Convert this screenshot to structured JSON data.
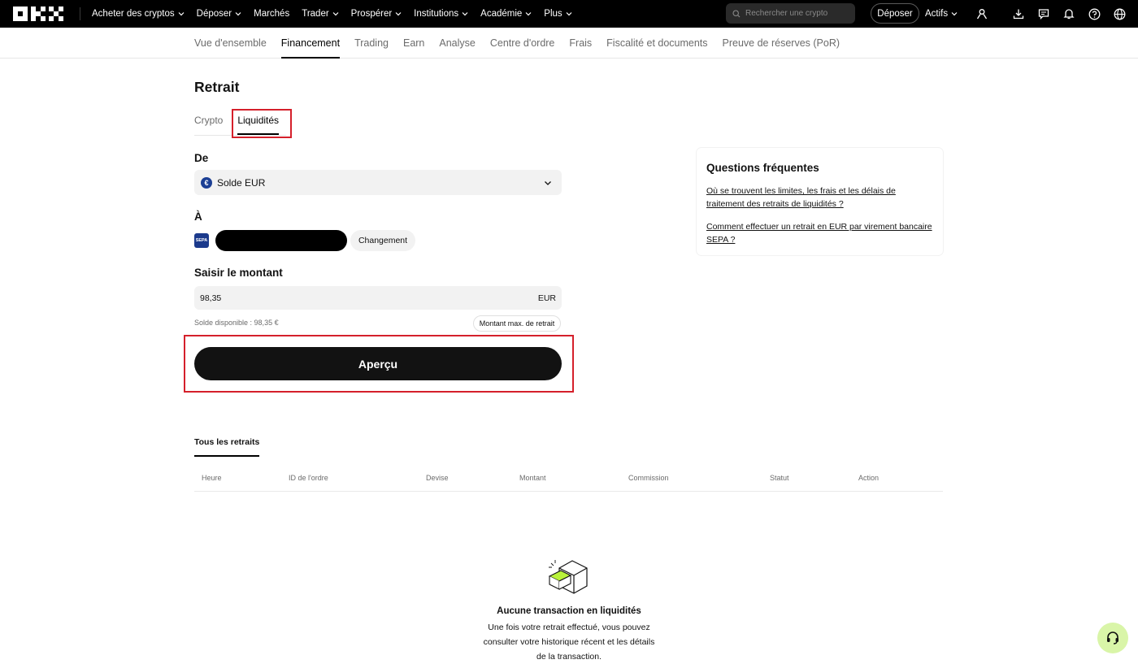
{
  "topbar": {
    "nav": [
      {
        "label": "Acheter des cryptos",
        "dropdown": true
      },
      {
        "label": "Déposer",
        "dropdown": true
      },
      {
        "label": "Marchés",
        "dropdown": false
      },
      {
        "label": "Trader",
        "dropdown": true
      },
      {
        "label": "Prospérer",
        "dropdown": true
      },
      {
        "label": "Institutions",
        "dropdown": true
      },
      {
        "label": "Académie",
        "dropdown": true
      },
      {
        "label": "Plus",
        "dropdown": true
      }
    ],
    "search_placeholder": "Rechercher une crypto",
    "deposit_label": "Déposer",
    "assets_label": "Actifs",
    "icons": [
      "user-icon",
      "download-icon",
      "chat-icon",
      "bell-icon",
      "help-icon",
      "globe-icon"
    ]
  },
  "subnav": {
    "items": [
      {
        "label": "Vue d'ensemble",
        "active": false
      },
      {
        "label": "Financement",
        "active": true
      },
      {
        "label": "Trading",
        "active": false
      },
      {
        "label": "Earn",
        "active": false
      },
      {
        "label": "Analyse",
        "active": false
      },
      {
        "label": "Centre d'ordre",
        "active": false
      },
      {
        "label": "Frais",
        "active": false
      },
      {
        "label": "Fiscalité et documents",
        "active": false
      },
      {
        "label": "Preuve de réserves (PoR)",
        "active": false
      }
    ]
  },
  "main": {
    "title": "Retrait",
    "tabs": [
      {
        "label": "Crypto",
        "active": false
      },
      {
        "label": "Liquidités",
        "active": true
      }
    ],
    "from_label": "De",
    "from_value": "Solde EUR",
    "from_coin_symbol": "€",
    "to_label": "À",
    "sepa_badge": "SEPA",
    "change_label": "Changement",
    "amount_label": "Saisir le montant",
    "amount_value": "98,35",
    "amount_unit": "EUR",
    "balance_text": "Solde disponible : 98,35 €",
    "max_label": "Montant max. de retrait",
    "preview_label": "Aperçu"
  },
  "faq": {
    "title": "Questions fréquentes",
    "links": [
      "Où se trouvent les limites, les frais et les délais de traitement des retraits de liquidités ?",
      "Comment effectuer un retrait en EUR par virement bancaire SEPA ?"
    ]
  },
  "history": {
    "tab_label": "Tous les retraits",
    "columns": [
      "Heure",
      "ID de l'ordre",
      "Devise",
      "Montant",
      "Commission",
      "Statut",
      "Action"
    ],
    "empty_title": "Aucune transaction en liquidités",
    "empty_desc": "Une fois votre retrait effectué, vous pouvez consulter votre historique récent et les détails de la transaction."
  },
  "colors": {
    "highlight": "#d5202b",
    "primary_button": "#121212",
    "support_bg": "#d9f5a8",
    "accent_green": "#b9f23a"
  }
}
